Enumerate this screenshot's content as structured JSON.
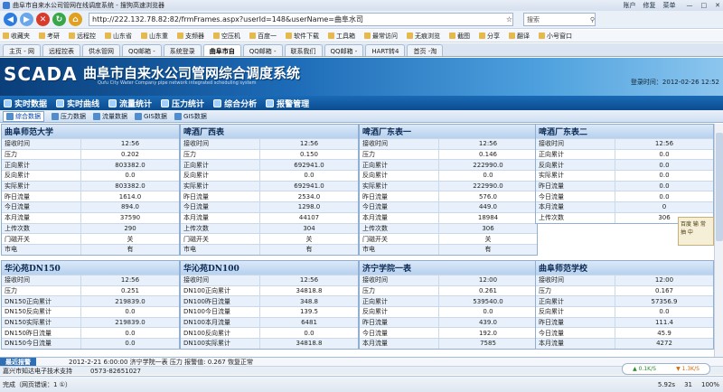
{
  "browser": {
    "window_title": "曲阜市自来水公司管网在线调度系统 - 搜狗高速浏览器",
    "title_links": [
      "账户",
      "修复",
      "菜单"
    ],
    "url": "http://222.132.78.82:82/frmFrames.aspx?userId=148&userName=曲阜水司",
    "search_placeholder": "搜索",
    "favorites": [
      "收藏夹",
      "考研",
      "远程控",
      "山东省",
      "山东重",
      "支频器",
      "空压机",
      "百度一",
      "软件下载",
      "工具箱",
      "最常访问",
      "无痕浏览",
      "截图",
      "分享",
      "翻译",
      "小号窗口"
    ],
    "tabs": [
      "主页 - 网",
      "远程控表",
      "供水管网",
      "QQ邮箱 -",
      "系统登录",
      "曲阜市自",
      "QQ邮箱 -",
      "联系我们",
      "QQ邮箱 -",
      "HART转4",
      "首页 -淘"
    ],
    "active_tab_index": 5
  },
  "app": {
    "logo": "SCADA",
    "system_name": "曲阜市自来水公司管网综合调度系统",
    "system_name_en": "Qufu City Water Company pipe network integrated scheduling system",
    "login_time_label": "登录时间：",
    "login_time": "2012-02-26 12:52",
    "menu": [
      "实时数据",
      "实时曲线",
      "流量统计",
      "压力统计",
      "综合分析",
      "报警管理"
    ],
    "subtabs": [
      "综合数据",
      "压力数据",
      "流量数据",
      "GIS数据",
      "GIS数据"
    ],
    "active_subtab_index": 0
  },
  "panels": [
    {
      "title": "曲阜师范大学",
      "rows": [
        [
          "接收时间",
          "12:56"
        ],
        [
          "压力",
          "0.202"
        ],
        [
          "正向累计",
          "803382.0"
        ],
        [
          "反向累计",
          "0.0"
        ],
        [
          "实际累计",
          "803382.0"
        ],
        [
          "昨日流量",
          "1614.0"
        ],
        [
          "今日流量",
          "894.0"
        ],
        [
          "本月流量",
          "37590"
        ],
        [
          "上传次数",
          "290"
        ],
        [
          "门磁开关",
          "关"
        ],
        [
          "市电",
          "有"
        ]
      ]
    },
    {
      "title": "啤酒厂西表",
      "rows": [
        [
          "接收时间",
          "12:56"
        ],
        [
          "压力",
          "0.150"
        ],
        [
          "正向累计",
          "692941.0"
        ],
        [
          "反向累计",
          "0.0"
        ],
        [
          "实际累计",
          "692941.0"
        ],
        [
          "昨日流量",
          "2534.0"
        ],
        [
          "今日流量",
          "1298.0"
        ],
        [
          "本月流量",
          "44107"
        ],
        [
          "上传次数",
          "304"
        ],
        [
          "门磁开关",
          "关"
        ],
        [
          "市电",
          "有"
        ]
      ]
    },
    {
      "title": "啤酒厂东表一",
      "rows": [
        [
          "接收时间",
          "12:56"
        ],
        [
          "压力",
          "0.146"
        ],
        [
          "正向累计",
          "222990.0"
        ],
        [
          "反向累计",
          "0.0"
        ],
        [
          "实际累计",
          "222990.0"
        ],
        [
          "昨日流量",
          "576.0"
        ],
        [
          "今日流量",
          "449.0"
        ],
        [
          "本月流量",
          "18984"
        ],
        [
          "上传次数",
          "306"
        ],
        [
          "门磁开关",
          "关"
        ],
        [
          "市电",
          "有"
        ]
      ]
    },
    {
      "title": "啤酒厂东表二",
      "rows": [
        [
          "接收时间",
          "12:56"
        ],
        [
          "正向累计",
          "0.0"
        ],
        [
          "反向累计",
          "0.0"
        ],
        [
          "实际累计",
          "0.0"
        ],
        [
          "昨日流量",
          "0.0"
        ],
        [
          "今日流量",
          "0.0"
        ],
        [
          "本月流量",
          "0"
        ],
        [
          "上传次数",
          "306"
        ]
      ]
    },
    {
      "title": "华沁苑DN150",
      "rows": [
        [
          "接收时间",
          "12:56"
        ],
        [
          "压力",
          "0.251"
        ],
        [
          "DN150正向累计",
          "219839.0"
        ],
        [
          "DN150反向累计",
          "0.0"
        ],
        [
          "DN150实际累计",
          "219839.0"
        ],
        [
          "DN150昨日流量",
          "0.0"
        ],
        [
          "DN150今日流量",
          "0.0"
        ]
      ]
    },
    {
      "title": "华沁苑DN100",
      "rows": [
        [
          "接收时间",
          "12:56"
        ],
        [
          "DN100正向累计",
          "34818.8"
        ],
        [
          "DN100昨日流量",
          "348.8"
        ],
        [
          "DN100今日流量",
          "139.5"
        ],
        [
          "DN100本月流量",
          "6481"
        ],
        [
          "DN100反向累计",
          "0.0"
        ],
        [
          "DN100实际累计",
          "34818.8"
        ]
      ]
    },
    {
      "title": "济宁学院一表",
      "rows": [
        [
          "接收时间",
          "12:00"
        ],
        [
          "压力",
          "0.261"
        ],
        [
          "正向累计",
          "539540.0"
        ],
        [
          "反向累计",
          "0.0"
        ],
        [
          "昨日流量",
          "439.0"
        ],
        [
          "今日流量",
          "192.0"
        ],
        [
          "本月流量",
          "7585"
        ]
      ]
    },
    {
      "title": "曲阜师范学校",
      "rows": [
        [
          "接收时间",
          "12:00"
        ],
        [
          "压力",
          "0.167"
        ],
        [
          "正向累计",
          "57356.9"
        ],
        [
          "反向累计",
          "0.0"
        ],
        [
          "昨日流量",
          "111.4"
        ],
        [
          "今日流量",
          "45.9"
        ],
        [
          "本月流量",
          "4272"
        ]
      ]
    }
  ],
  "widget_text": "百度 输 常 抽 中",
  "alarm": {
    "tab_label": "最近报警",
    "text": "2012-2-21 6:00:00 济宁学院一表  压力  报警值: 0.267 恢复正常"
  },
  "footer": {
    "company": "嘉兴市知达电子技术支持",
    "phone": "0573-82651027"
  },
  "net": {
    "up": "0.1K/S",
    "down": "1.3K/S"
  },
  "status": {
    "left": "完成（网页错误：1 ①）",
    "items": [
      "5.92s",
      "31",
      "100%"
    ]
  }
}
